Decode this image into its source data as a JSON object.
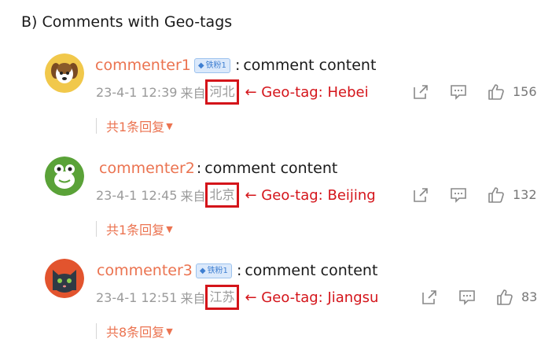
{
  "section": {
    "title": "B) Comments with Geo-tags"
  },
  "badge_text": "铁粉1",
  "separator": ":",
  "from_label": "来自",
  "comments": [
    {
      "username": "commenter1",
      "has_badge": true,
      "content": "comment content",
      "time": "23-4-1 12:39",
      "location": "河北",
      "annotation": "← Geo-tag: Hebei",
      "likes": "156",
      "replies": "共1条回复",
      "avatar": "dog-avatar"
    },
    {
      "username": "commenter2",
      "has_badge": false,
      "content": "comment content",
      "time": "23-4-1 12:45",
      "location": "北京",
      "annotation": "← Geo-tag: Beijing",
      "likes": "132",
      "replies": "共1条回复",
      "avatar": "frog-avatar"
    },
    {
      "username": "commenter3",
      "has_badge": true,
      "content": "comment content",
      "time": "23-4-1 12:51",
      "location": "江苏",
      "annotation": "← Geo-tag: Jiangsu",
      "likes": "83",
      "replies": "共8条回复",
      "avatar": "cat-avatar"
    }
  ],
  "colors": {
    "username": "#eb7350",
    "annotation": "#d4141a",
    "badge": "#3f7fd1"
  },
  "icons": [
    "share-icon",
    "comment-icon",
    "like-icon",
    "chevron-down-icon"
  ]
}
